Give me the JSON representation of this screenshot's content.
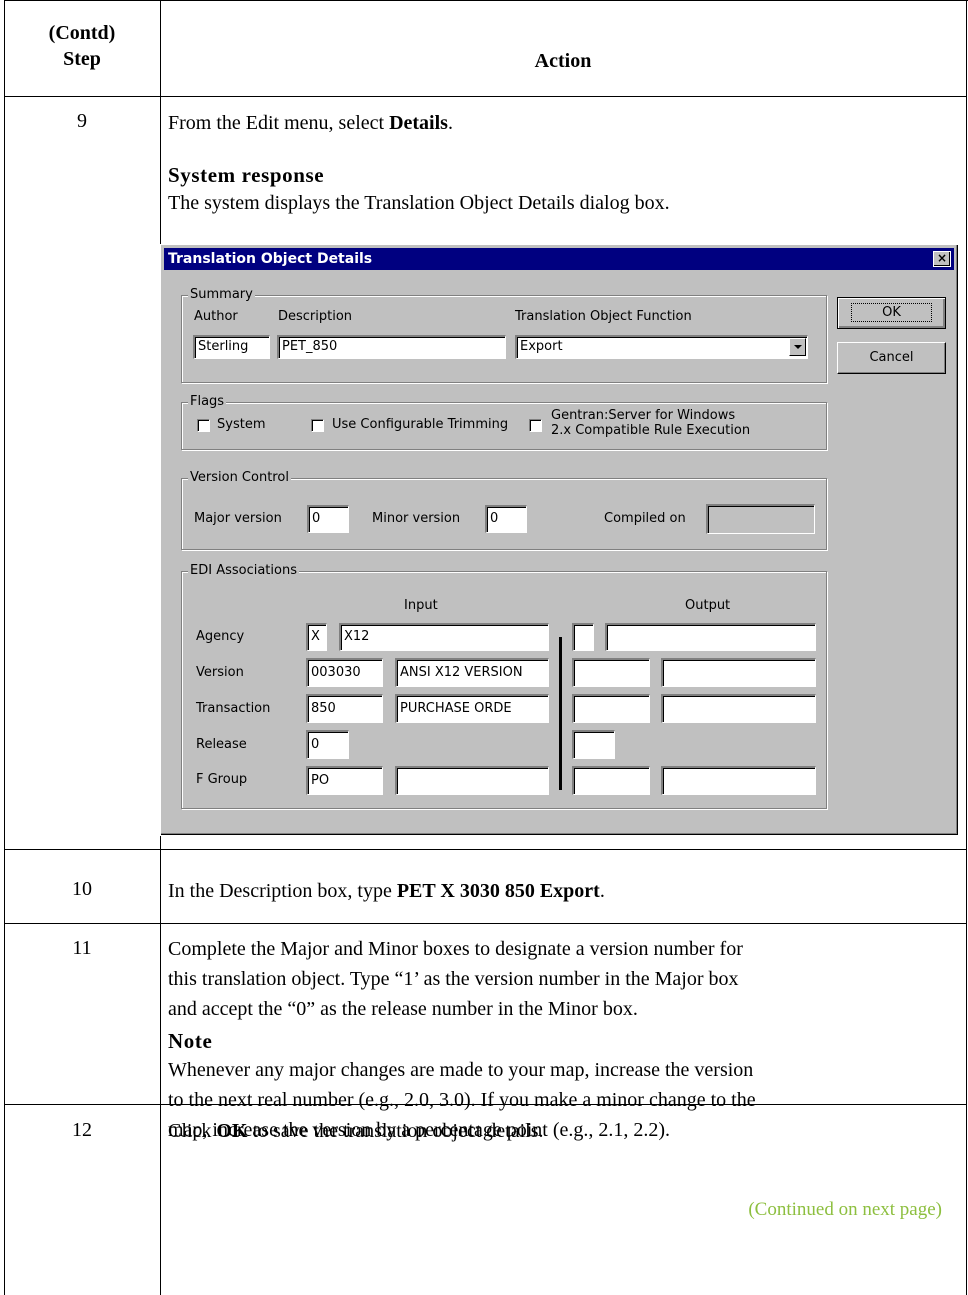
{
  "header": {
    "step_line1": "(Contd)",
    "step_line2": "Step",
    "action": "Action"
  },
  "rows": [
    {
      "step": "9",
      "text_pre": "From the Edit menu, select ",
      "text_bold": "Details",
      "text_post": ".",
      "subheading": "System response",
      "subtext": "The system displays the Translation Object Details dialog box."
    },
    {
      "step": "10",
      "text_pre": "In the Description box, type ",
      "text_bold": "PET X 3030 850 Export",
      "text_post": "."
    },
    {
      "step": "11",
      "text_line1": "Complete the Major and Minor boxes to designate a version number for",
      "text_line2": "this translation object. Type “1’ as the version number in the Major box",
      "text_line3": "and accept the “0” as the release number in the Minor box.",
      "subheading": "Note",
      "note_line1": "Whenever any major changes are made to your map, increase the version",
      "note_line2": "to the next real number (e.g., 2.0, 3.0). If you make a minor change to the",
      "note_line3": "map, increase the version by a percentage point (e.g., 2.1, 2.2)."
    },
    {
      "step": "12",
      "text_pre": "Click ",
      "text_bold": "OK",
      "text_post": " to save the translation object details."
    }
  ],
  "continued": "(Continued on next page)",
  "dialog": {
    "title": "Translation Object Details",
    "close": "×",
    "ok": "OK",
    "cancel": "Cancel",
    "summary": {
      "title": "Summary",
      "author_label": "Author",
      "author_value": "Sterling",
      "description_label": "Description",
      "description_value": "PET_850",
      "function_label": "Translation Object Function",
      "function_value": "Export"
    },
    "flags": {
      "title": "Flags",
      "system": "System",
      "trimming": "Use Configurable Trimming",
      "gentran_line1": "Gentran:Server for Windows",
      "gentran_line2": "2.x Compatible Rule Execution"
    },
    "version": {
      "title": "Version Control",
      "major_label": "Major version",
      "major_value": "0",
      "minor_label": "Minor version",
      "minor_value": "0",
      "compiled_label": "Compiled on",
      "compiled_value": ""
    },
    "edi": {
      "title": "EDI Associations",
      "input": "Input",
      "output": "Output",
      "agency_label": "Agency",
      "agency_code": "X",
      "agency_name": "X12",
      "version_label": "Version",
      "version_code": "003030",
      "version_name": "ANSI X12 VERSION",
      "transaction_label": "Transaction",
      "transaction_code": "850",
      "transaction_name": "PURCHASE ORDE",
      "release_label": "Release",
      "release_value": "0",
      "fgroup_label": "F Group",
      "fgroup_code": "PO",
      "fgroup_name": ""
    }
  }
}
